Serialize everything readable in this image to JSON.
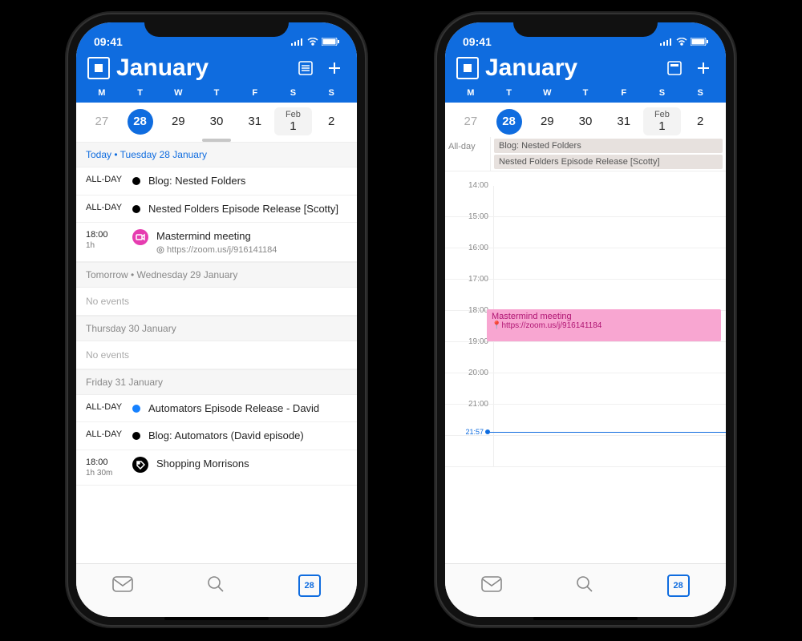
{
  "status": {
    "time": "09:41"
  },
  "header": {
    "month": "January"
  },
  "week": {
    "labels": [
      "M",
      "T",
      "W",
      "T",
      "F",
      "S",
      "S"
    ],
    "days": [
      "27",
      "28",
      "29",
      "30",
      "31",
      "Feb 1",
      "2"
    ],
    "selected": "28"
  },
  "agenda": {
    "todayHeader": "Today • Tuesday 28 January",
    "today": [
      {
        "time": "ALL-DAY",
        "title": "Blog: Nested Folders",
        "dot": "black"
      },
      {
        "time": "ALL-DAY",
        "title": "Nested Folders Episode Release [Scotty]",
        "dot": "black"
      },
      {
        "time": "18:00",
        "dur": "1h",
        "title": "Mastermind meeting",
        "sub": "https://zoom.us/j/916141184",
        "dot": "pink"
      }
    ],
    "tomorrowHeader": "Tomorrow • Wednesday 29 January",
    "noEvents": "No events",
    "thuHeader": "Thursday 30 January",
    "friHeader": "Friday 31 January",
    "fri": [
      {
        "time": "ALL-DAY",
        "title": "Automators Episode Release - David",
        "dot": "blue"
      },
      {
        "time": "ALL-DAY",
        "title": "Blog: Automators (David episode)",
        "dot": "black"
      },
      {
        "time": "18:00",
        "dur": "1h 30m",
        "title": "Shopping Morrisons",
        "dot": "shop"
      }
    ]
  },
  "dayview": {
    "alldayLabel": "All-day",
    "allday": [
      "Blog: Nested Folders",
      "Nested Folders Episode Release [Scotty]"
    ],
    "hours": [
      "14:00",
      "15:00",
      "16:00",
      "17:00",
      "18:00",
      "19:00",
      "20:00",
      "21:00"
    ],
    "event": {
      "title": "Mastermind meeting",
      "sub": "https://zoom.us/j/916141184"
    },
    "now": "21:57"
  },
  "tabs": {
    "calNum": "28"
  }
}
